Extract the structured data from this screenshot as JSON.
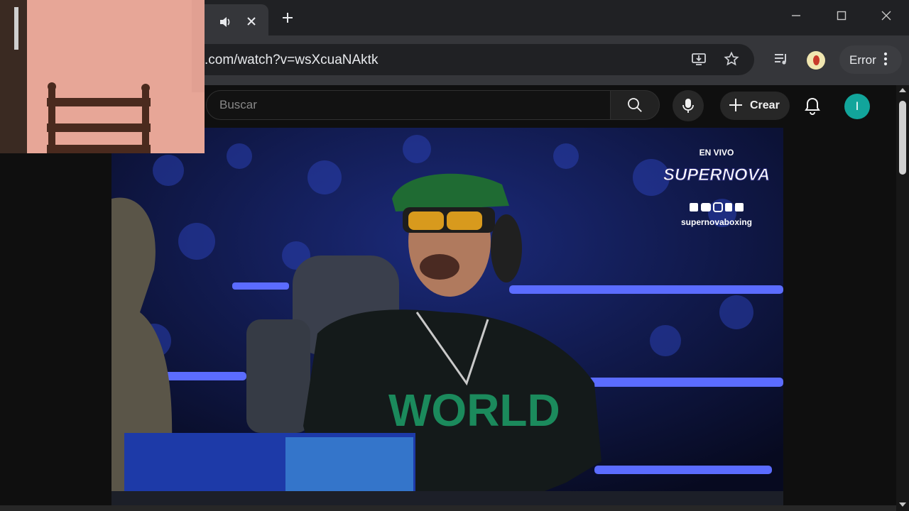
{
  "browser": {
    "tab": {
      "audio_icon": "speaker-icon",
      "close_icon": "close-icon"
    },
    "new_tab_icon": "plus-icon",
    "window_controls": [
      "minimize-icon",
      "maximize-icon",
      "close-icon"
    ],
    "address_bar": {
      "url": ".com/watch?v=wsXcuaNAktk"
    },
    "toolbar_icons": [
      "install-app-icon",
      "bookmark-star-icon",
      "media-queue-icon"
    ],
    "profile_chip": {
      "label": "Error"
    }
  },
  "youtube": {
    "search": {
      "placeholder": "Buscar",
      "value": ""
    },
    "create_button": {
      "label": "Crear"
    },
    "avatar_letter": "I"
  },
  "video": {
    "overlay": {
      "en_vivo": "EN VIVO",
      "brand": "SUPERNOVA",
      "handle": "supernovaboxing"
    },
    "shirt_text": "WORLD"
  },
  "colors": {
    "chrome_dark": "#202124",
    "chrome_toolbar": "#35363a",
    "yt_bg": "#0f0f0f",
    "avatar_teal": "#12a59b",
    "stage_blue": "#4a63ff",
    "webcam_wall": "#e8a99a"
  }
}
